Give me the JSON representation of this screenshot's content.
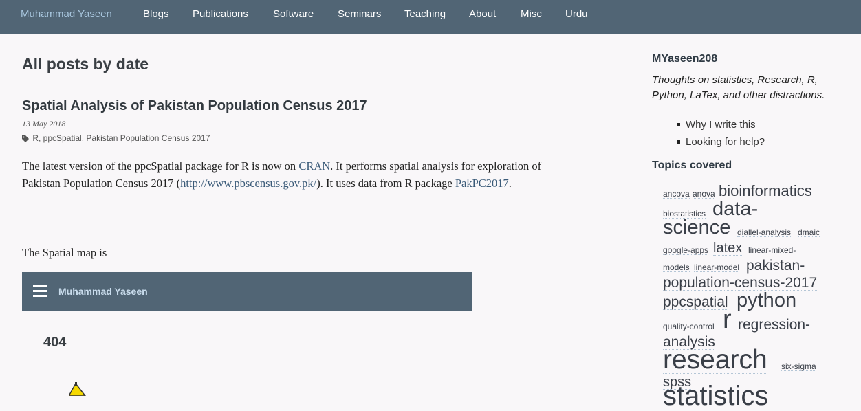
{
  "nav": {
    "brand": "Muhammad Yaseen",
    "items": [
      "Blogs",
      "Publications",
      "Software",
      "Seminars",
      "Teaching",
      "About",
      "Misc",
      "Urdu"
    ]
  },
  "main": {
    "page_title": "All posts by date",
    "post": {
      "title": "Spatial Analysis of Pakistan Population Census 2017",
      "date": "13 May 2018",
      "tags": "R, ppcSpatial, Pakistan Population Census 2017",
      "body": {
        "p1_a": "The latest version of the ppcSpatial package for R is now on ",
        "link_cran": "CRAN",
        "p1_b": ". It performs spatial analysis for exploration of Pakistan Population Census 2017 (",
        "link_pbs": "http://www.pbscensus.gov.pk/",
        "p1_c": "). It uses data from R package ",
        "link_pakpc": "PakPC2017",
        "p1_d": "."
      },
      "map_intro": "The Spatial map is",
      "embed": {
        "brand": "Muhammad Yaseen",
        "error": "404"
      }
    }
  },
  "sidebar": {
    "title": "MYaseen208",
    "description": "Thoughts on statistics, Research, R, Python, LaTex, and other distractions.",
    "links": [
      "Why I write this",
      "Looking for help?"
    ],
    "topics_title": "Topics covered",
    "tags": [
      "ancova",
      "anova",
      "bioinformatics",
      "biostatistics",
      "data-",
      "science",
      "diallel-analysis",
      "dmaic",
      "google-apps",
      "latex",
      "linear-mixed-",
      "models",
      "linear-model",
      "pakistan-",
      "population-census-2017",
      "ppcspatial",
      "python",
      "quality-control",
      "r",
      "regression-",
      "analysis",
      "research",
      "six-sigma",
      "spss",
      "statistics"
    ]
  },
  "colors": {
    "nav_bg": "#516575",
    "brand_link": "#a8c6de",
    "page_bg": "#f9f7f9",
    "warning_yellow": "#f5d800"
  }
}
